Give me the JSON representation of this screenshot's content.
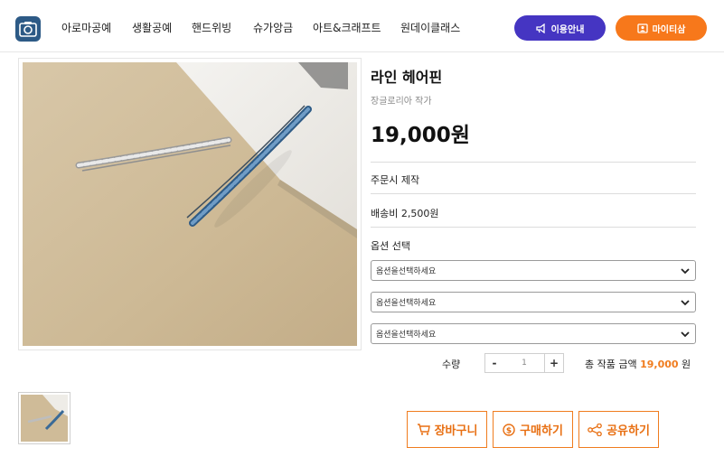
{
  "header": {
    "logo_icon": "photo-logo-icon",
    "nav": [
      {
        "label": "아로마공예",
        "w": 78
      },
      {
        "label": "생활공예",
        "w": 66
      },
      {
        "label": "핸드위빙",
        "w": 68
      },
      {
        "label": "슈가앙금",
        "w": 66
      },
      {
        "label": "아트&크래프트",
        "w": 97
      },
      {
        "label": "원데이클래스",
        "w": 80
      }
    ],
    "guide_label": "이용안내",
    "my_label": "마이티삼"
  },
  "product": {
    "title": "라인 헤어핀",
    "artist": "장글로리아 작가",
    "price": "19,000원",
    "made_to_order": "주문시 제작",
    "shipping": "배송비 2,500원",
    "option_heading": "옵션 선택",
    "options": [
      "옵션을선택하세요",
      "옵션을선택하세요",
      "옵션을선택하세요"
    ],
    "qty_label": "수량",
    "qty_minus": "-",
    "qty_value": "1",
    "qty_plus": "+",
    "total_label": "총 작품 금액",
    "total_amount": "19,000",
    "total_unit": "원"
  },
  "actions": {
    "cart": "장바구니",
    "buy": "구매하기",
    "share": "공유하기"
  },
  "colors": {
    "guide_button": "#4535c2",
    "my_button": "#f7781b",
    "accent": "#f07c1e"
  }
}
